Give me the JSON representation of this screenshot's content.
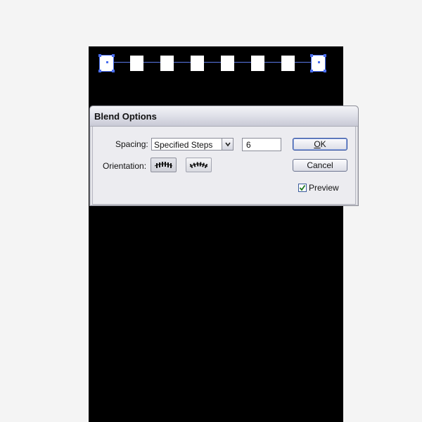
{
  "canvas": {
    "blend_steps_shown": 8
  },
  "dialog": {
    "title": "Blend Options",
    "spacing_label": "Spacing:",
    "spacing_value": "Specified Steps",
    "steps_value": "6",
    "orientation_label": "Orientation:",
    "ok_label": "OK",
    "ok_mnemonic": "O",
    "ok_rest": "K",
    "cancel_label": "Cancel",
    "preview_label": "Preview",
    "preview_checked": true
  },
  "colors": {
    "artboard": "#000000",
    "selection": "#4a6ef0",
    "dialog_bg": "#ececf0"
  },
  "icons": {
    "align_to_page": "orientation-align-to-page-icon",
    "align_to_path": "orientation-align-to-path-icon",
    "dropdown": "chevron-down-icon",
    "check": "check-icon"
  }
}
